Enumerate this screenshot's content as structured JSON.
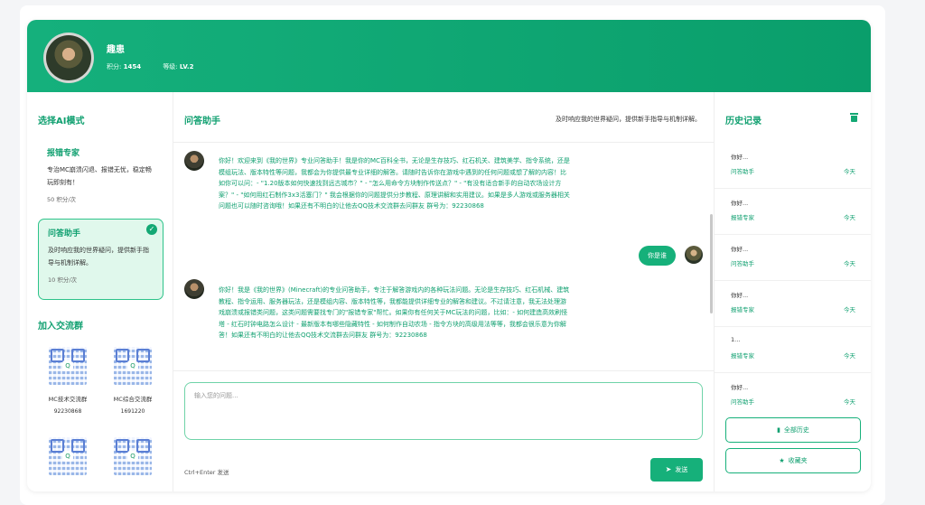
{
  "user": {
    "name": "趣患",
    "score_label": "积分:",
    "score": "1454",
    "level_label": "等级:",
    "level": "LV.2"
  },
  "left": {
    "mode_title": "选择AI模式",
    "modes": [
      {
        "name": "报错专家",
        "desc": "专治MC崩溃闪退、报错无忧，稳定畅玩即刻有！",
        "cost": "50 积分/次",
        "active": false
      },
      {
        "name": "问答助手",
        "desc": "及时响应我的世界疑问，提供新手指导与机制详解。",
        "cost": "10 积分/次",
        "active": true
      }
    ],
    "group_title": "加入交流群",
    "groups": [
      {
        "name": "MC技术交流群",
        "number": "92230868"
      },
      {
        "name": "MC综合交流群",
        "number": "1691220"
      }
    ]
  },
  "chat": {
    "title": "问答助手",
    "subtitle": "及时响应我的世界疑问，提供新手指导与机制详解。",
    "messages": [
      {
        "role": "bot",
        "text": "你好！欢迎来到《我的世界》专业问答助手！我是你的MC百科全书，无论是生存技巧、红石机关、建筑美学、指令系统，还是模组玩法、版本特性等问题，我都会为你提供最专业详细的解答。请随时告诉你在游戏中遇到的任何问题或想了解的内容！比如你可以问：- \"1.20版本如何快速找到远古城市？\" - \"怎么用命令方块制作传送点？\" - \"有没有适合新手的自动农场设计方案？\" - \"如何用红石制作3x3活塞门？\" 我会根据你的问题提供分步教程、原理讲解和实用建议。如果是多人游戏或服务器相关问题也可以随时咨询哦！如果还有不明白的让他去QQ技术交流群去问群友 群号为：92230868"
      },
      {
        "role": "user",
        "text": "你是谁"
      },
      {
        "role": "bot",
        "text": "你好！我是《我的世界》(Minecraft)的专业问答助手，专注于解答游戏内的各种玩法问题。无论是生存技巧、红石机械、建筑教程、指令运用、服务器玩法，还是模组内容、版本特性等，我都能提供详细专业的解答和建议。不过请注意，我无法处理游戏崩溃或报错类问题，这类问题需要找专门的\"报错专家\"帮忙。如果你有任何关于MC玩法的问题，比如：- 如何建造高效刷怪塔 - 红石时钟电路怎么设计 - 最新版本有哪些隐藏特性 - 如何制作自动农场 - 指令方块的高级用法等等，我都会很乐意为你解答！如果还有不明白的让他去QQ技术交流群去问群友 群号为：92230868"
      }
    ],
    "input_placeholder": "输入您的问题...",
    "hint": "Ctrl+Enter 发送",
    "send_label": "发送"
  },
  "history": {
    "title": "历史记录",
    "items": [
      {
        "q": "你好...",
        "mode": "问答助手",
        "time": "今天"
      },
      {
        "q": "你好...",
        "mode": "报错专家",
        "time": "今天"
      },
      {
        "q": "你好...",
        "mode": "问答助手",
        "time": "今天"
      },
      {
        "q": "你好...",
        "mode": "报错专家",
        "time": "今天"
      },
      {
        "q": "1...",
        "mode": "报错专家",
        "time": "今天"
      },
      {
        "q": "你好...",
        "mode": "问答助手",
        "time": "今天"
      }
    ],
    "all_label": "全部历史",
    "fav_label": "收藏夹"
  },
  "colors": {
    "accent": "#16b07a",
    "accent_dark": "#10a070",
    "active_bg": "#e0f8ec"
  }
}
